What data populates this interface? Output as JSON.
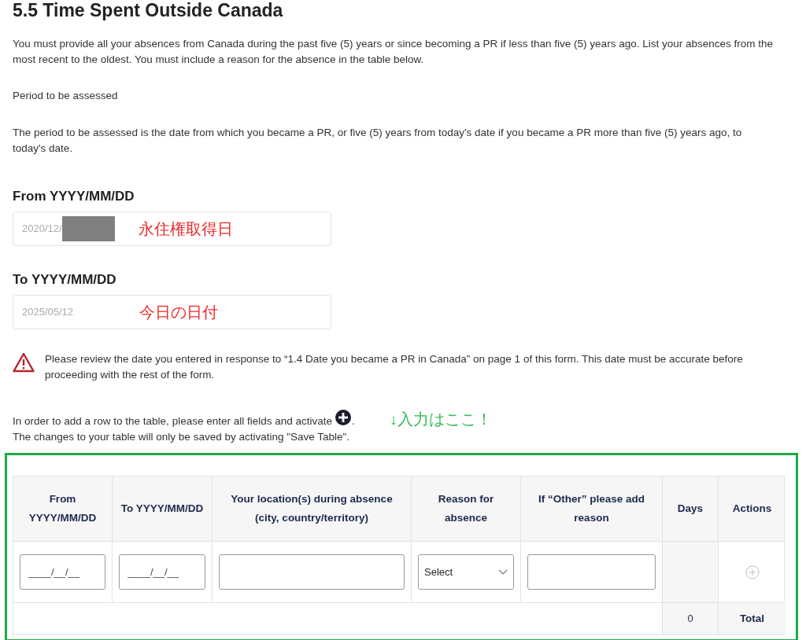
{
  "title": "5.5 Time Spent Outside Canada",
  "intro": "You must provide all your absences from Canada during the past five (5) years or since becoming a PR if less than five (5) years ago. List your absences from the most recent to the oldest. You must include a reason for the absence in the table below.",
  "period_heading": "Period to be assessed",
  "period_text": "The period to be assessed is the date from which you became a PR, or five (5) years from today's date if you became a PR more than five (5) years ago, to today's date.",
  "date_fields": [
    {
      "label": "From YYYY/MM/DD",
      "value": "2020/12/",
      "disabled": true,
      "redacted": true,
      "annotation": "永住権取得日"
    },
    {
      "label": "To YYYY/MM/DD",
      "value": "2025/05/12",
      "disabled": true,
      "redacted": false,
      "annotation": "今日の日付"
    }
  ],
  "warning": "Please review the date you entered in response to “1.4 Date you became a PR in Canada” on page 1 of this form. This date must be accurate before proceeding with the rest of the form.",
  "instructions": [
    "In order to add a row to the table, please enter all fields and activate",
    "The changes to your table will only be saved by activating \"Save Table\"."
  ],
  "instructions_period": ".",
  "callout": "↓入力はここ！",
  "table": {
    "columns": [
      {
        "heading": "From YYYY/MM/DD",
        "kind": "date",
        "placeholder": "____/__/__"
      },
      {
        "heading": "To YYYY/MM/DD",
        "kind": "date",
        "placeholder": "____/__/__"
      },
      {
        "heading": "Your location(s) during absence (city, country/territory)",
        "kind": "text"
      },
      {
        "heading": "Reason for absence",
        "kind": "select",
        "value": "Select"
      },
      {
        "heading": "If “Other” please add reason",
        "kind": "text"
      },
      {
        "heading": "Days",
        "kind": "days"
      },
      {
        "heading": "Actions",
        "kind": "action"
      }
    ],
    "days_total": "0",
    "total_label": "Total"
  }
}
